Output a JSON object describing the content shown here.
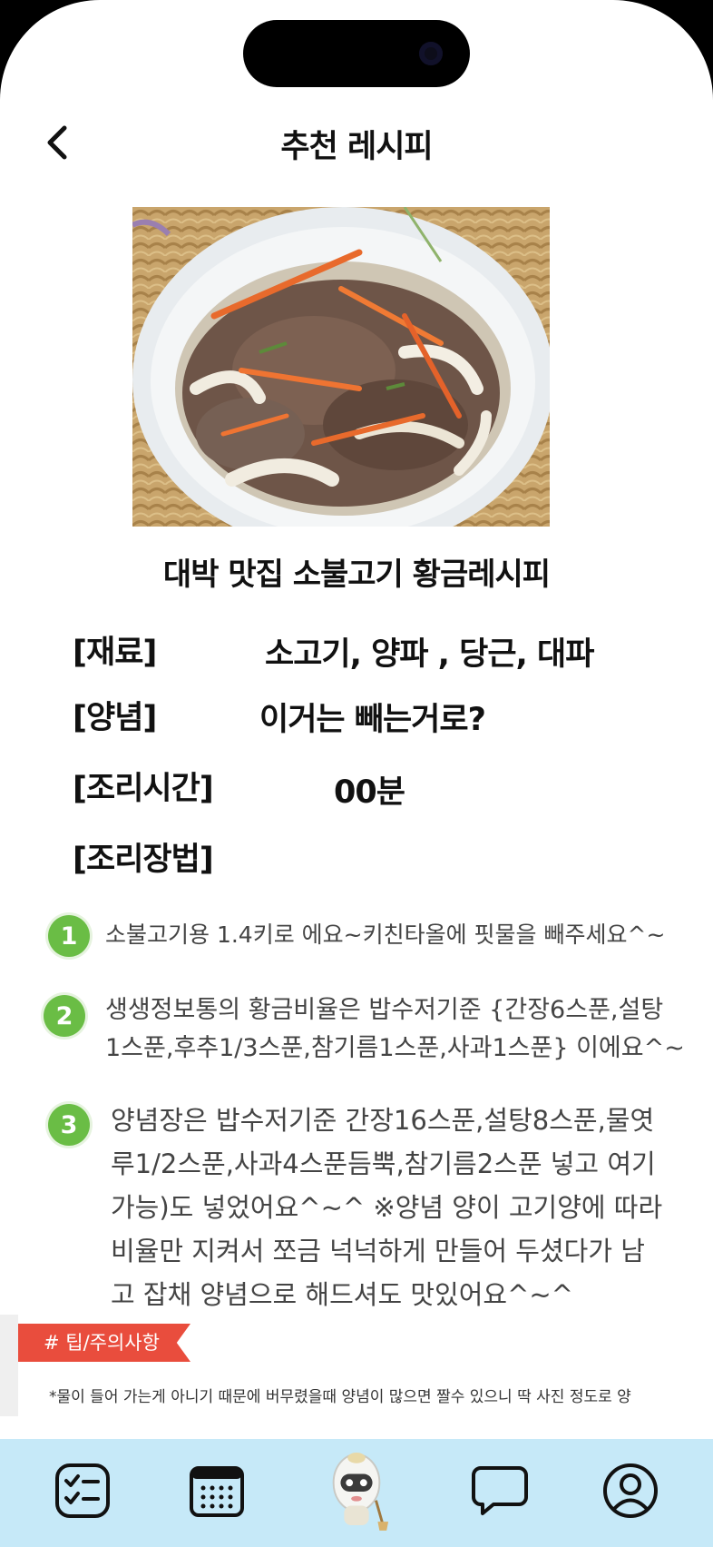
{
  "header": {
    "title": "추천 레시피"
  },
  "recipe": {
    "name": "대박 맛집 소불고기 황금레시피",
    "info": [
      {
        "label": "[재료]",
        "value": "소고기,  양파 , 당근, 대파"
      },
      {
        "label": "[양념]",
        "value": "이거는 빼는거로?"
      },
      {
        "label": "[조리시간]",
        "value": "00분"
      },
      {
        "label": "[조리장법]",
        "value": ""
      }
    ],
    "steps": [
      {
        "num": "1",
        "lines": [
          "소불고기용 1.4키로 에요~키친타올에 핏물을 빼주세요^~"
        ]
      },
      {
        "num": "2",
        "lines": [
          "생생정보통의 황금비율은 밥수저기준 {간장6스푼,설탕",
          "1스푼,후추1/3스푼,참기름1스푼,사과1스푼} 이에요^~"
        ]
      },
      {
        "num": "3",
        "lines": [
          "양념장은 밥수저기준 간장16스푼,설탕8스푼,물엿",
          "루1/2스푼,사과4스푼듬뿍,참기름2스푼 넣고 여기",
          "가능)도 넣었어요^~^ ※양념 양이 고기양에 따라",
          "비율만 지켜서 쪼금 넉넉하게 만들어 두셨다가 남",
          "고 잡채 양념으로 해드셔도 맛있어요^~^"
        ]
      }
    ]
  },
  "tip": {
    "tag": "# 팁/주의사항",
    "text": "*물이 들어 가는게 아니기 때문에 버무렸을때 양념이 많으면 짤수 있으니 딱 사진 정도로 양"
  },
  "nav": {
    "items": [
      {
        "name": "checklist-icon"
      },
      {
        "name": "calendar-icon"
      },
      {
        "name": "mascot-icon"
      },
      {
        "name": "chat-icon"
      },
      {
        "name": "profile-icon"
      }
    ]
  },
  "colors": {
    "accent_green": "#6abd45",
    "tip_red": "#e94d3d",
    "nav_bg": "#c6e9f8"
  }
}
